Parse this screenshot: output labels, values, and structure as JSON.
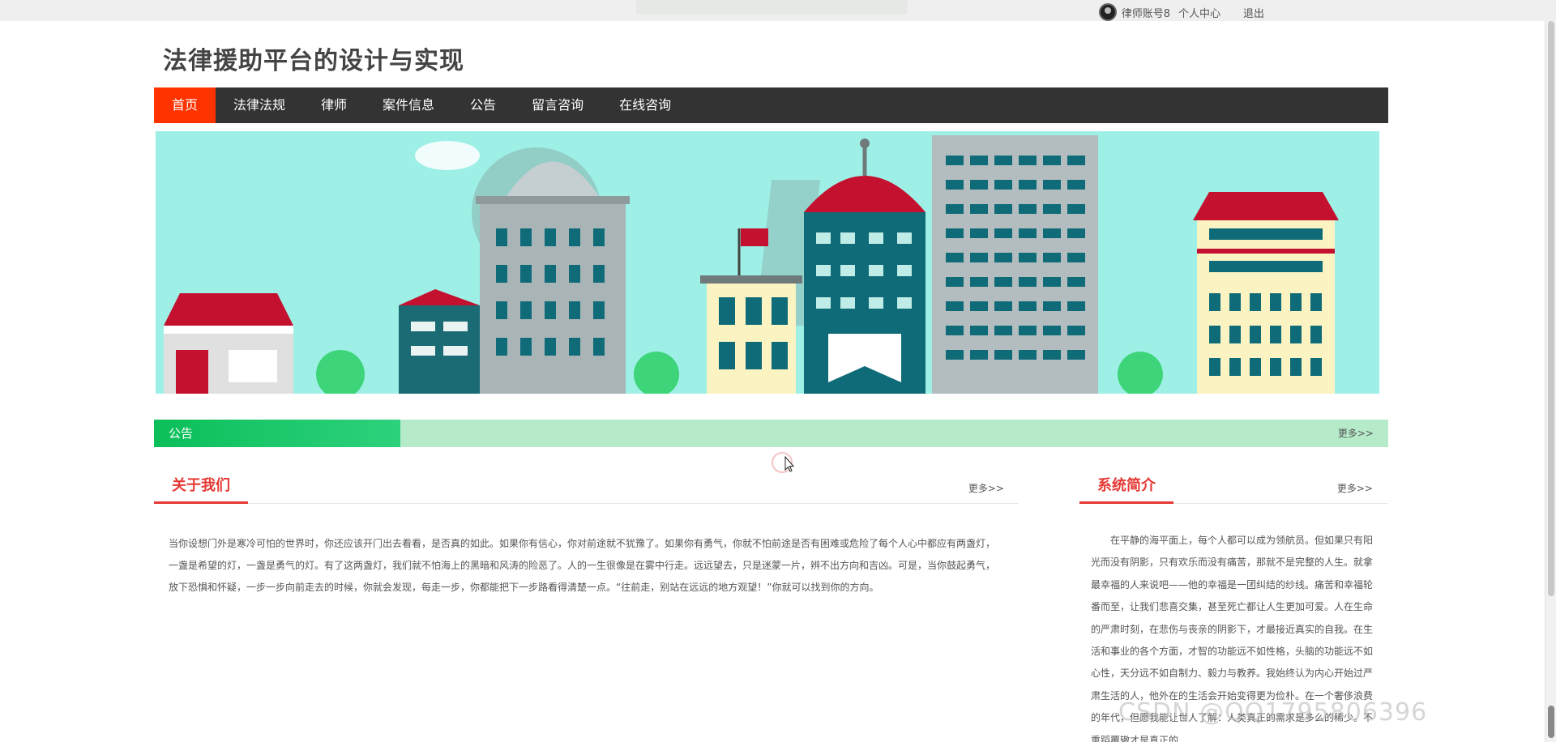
{
  "topbar": {
    "username": "律师账号8",
    "personal_center": "个人中心",
    "logout": "退出"
  },
  "site": {
    "title": "法律援助平台的设计与实现"
  },
  "nav": {
    "items": [
      "首页",
      "法律法规",
      "律师",
      "案件信息",
      "公告",
      "留言咨询",
      "在线咨询"
    ],
    "active": "首页"
  },
  "notice": {
    "label": "公告",
    "more": "更多>>"
  },
  "about": {
    "title": "关于我们",
    "more": "更多>>",
    "text": "当你设想门外是寒冷可怕的世界时，你还应该开门出去看看，是否真的如此。如果你有信心，你对前途就不犹豫了。如果你有勇气，你就不怕前途是否有困难或危险了每个人心中都应有两盏灯，一盏是希望的灯，一盏是勇气的灯。有了这两盏灯，我们就不怕海上的黑暗和风涛的险恶了。人的一生很像是在雾中行走。远远望去，只是迷蒙一片，辨不出方向和吉凶。可是，当你鼓起勇气，放下恐惧和怀疑，一步一步向前走去的时候，你就会发现，每走一步，你都能把下一步路看得清楚一点。“往前走，别站在远远的地方观望！”你就可以找到你的方向。"
  },
  "intro": {
    "title": "系统简介",
    "more": "更多>>",
    "text": "在平静的海平面上，每个人都可以成为领航员。但如果只有阳光而没有阴影，只有欢乐而没有痛苦，那就不是完整的人生。就拿最幸福的人来说吧——他的幸福是一团纠结的纱线。痛苦和幸福轮番而至，让我们悲喜交集，甚至死亡都让人生更加可爱。人在生命的严肃时刻，在悲伤与丧亲的阴影下，才最接近真实的自我。在生活和事业的各个方面，才智的功能远不如性格，头脑的功能远不如心性，天分远不如自制力、毅力与教养。我始终认为内心开始过严肃生活的人，他外在的生活会开始变得更为俭朴。在一个奢侈浪费的年代，但愿我能让世人了解：人类真正的需求是多么的稀少。不重蹈覆辙才是真正的"
  },
  "watermark": "CSDN @QQ1795806396",
  "colors": {
    "nav_bg": "#333333",
    "nav_active": "#ff3300",
    "accent_red": "#e53935",
    "notice_green": "#0bbf5a",
    "notice_bar": "#b6ebca"
  }
}
